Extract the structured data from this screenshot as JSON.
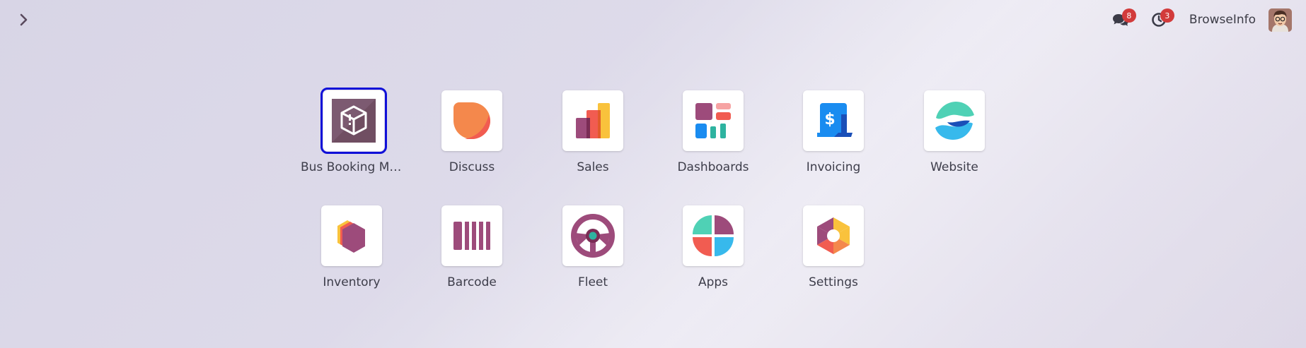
{
  "navbar": {
    "toggle_icon": "chevron-right-icon",
    "messages": {
      "icon": "chat-icon",
      "count": "8"
    },
    "activities": {
      "icon": "clock-icon",
      "count": "3"
    },
    "company": "BrowseInfo",
    "avatar": "user-avatar"
  },
  "apps": [
    {
      "label": "Bus Booking Ma…",
      "icon": "bus-booking-icon",
      "selected": true
    },
    {
      "label": "Discuss",
      "icon": "discuss-icon"
    },
    {
      "label": "Sales",
      "icon": "sales-icon"
    },
    {
      "label": "Dashboards",
      "icon": "dashboards-icon"
    },
    {
      "label": "Invoicing",
      "icon": "invoicing-icon"
    },
    {
      "label": "Website",
      "icon": "website-icon"
    },
    {
      "label": "Inventory",
      "icon": "inventory-icon"
    },
    {
      "label": "Barcode",
      "icon": "barcode-icon"
    },
    {
      "label": "Fleet",
      "icon": "fleet-icon"
    },
    {
      "label": "Apps",
      "icon": "apps-icon"
    },
    {
      "label": "Settings",
      "icon": "settings-icon"
    }
  ],
  "colors": {
    "selection": "#1010d8",
    "badge": "#d23b3b",
    "purple": "#985184"
  }
}
